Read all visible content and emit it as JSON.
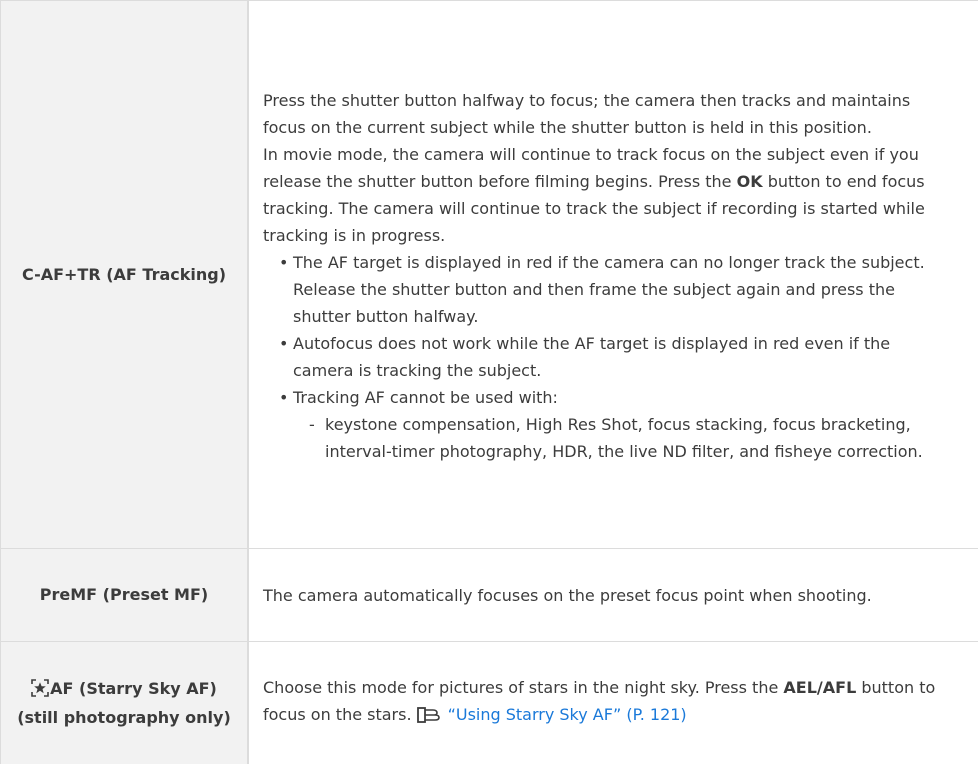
{
  "rows": [
    {
      "label": "C-AF+TR (AF Tracking)",
      "desc_p1": "Press the shutter button halfway to focus; the camera then tracks and maintains focus on the current subject while the shutter button is held in this position.",
      "desc_p2_a": "In movie mode, the camera will continue to track focus on the subject even if you release the shutter button before filming begins. Press the ",
      "desc_p2_b": "OK",
      "desc_p2_c": " button to end focus tracking. The camera will continue to track the subject if recording is started while tracking is in progress.",
      "bullets": [
        "The AF target is displayed in red if the camera can no longer track the subject. Release the shutter button and then frame the subject again and press the shutter button halfway.",
        "Autofocus does not work while the AF target is displayed in red even if the camera is tracking the subject.",
        "Tracking AF cannot be used with:"
      ],
      "sub_bullet_marker": "-",
      "sub_bullets": [
        "keystone compensation, High Res Shot, focus stacking, focus bracketing, interval-timer photography, HDR, the live ND filter, and fisheye correction."
      ],
      "bullet_marker": "•"
    },
    {
      "label": "PreMF (Preset MF)",
      "desc": "The camera automatically focuses on the preset focus point when shooting."
    },
    {
      "label_icon": "starry-sky-icon",
      "label": "AF (Starry Sky AF) (still photography only)",
      "desc_a": "Choose this mode for pictures of stars in the night sky. Press the ",
      "desc_b": "AEL/AFL",
      "desc_c": " button to focus on the stars.",
      "ref_icon": "page-reference-icon",
      "link": "“Using Starry Sky AF” (P. 121)"
    }
  ],
  "colors": {
    "label_bg": "#f2f2f2",
    "border": "#dcdcdc",
    "text": "#3c3c3c",
    "link": "#1a79d9"
  }
}
